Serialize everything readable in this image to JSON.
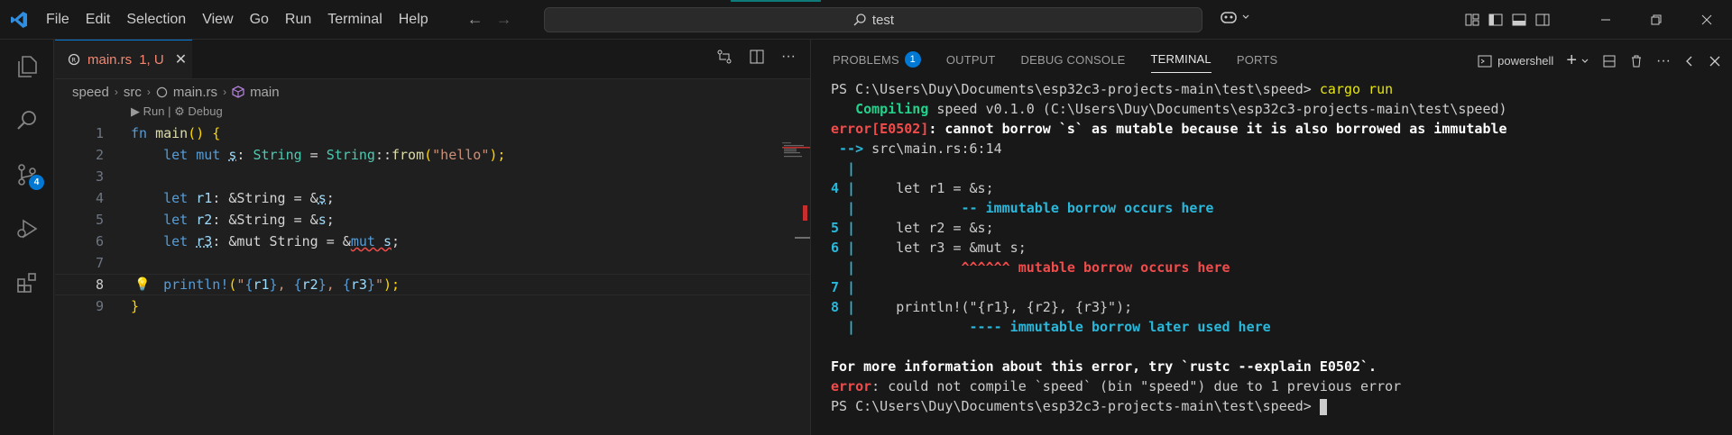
{
  "menu": [
    "File",
    "Edit",
    "Selection",
    "View",
    "Go",
    "Run",
    "Terminal",
    "Help"
  ],
  "search": {
    "text": "test"
  },
  "colors": {
    "accent": "#0078d4",
    "error": "#f14c4c",
    "success": "#23d18b"
  },
  "activity": {
    "scm_badge": "4"
  },
  "editor": {
    "tab": {
      "filename": "main.rs",
      "status": "1, U"
    },
    "breadcrumb": {
      "folder": "speed",
      "sub": "src",
      "file": "main.rs",
      "symbol": "main"
    },
    "codelens": {
      "run": "Run",
      "sep": "|",
      "debug": "Debug"
    },
    "line_numbers": [
      "1",
      "2",
      "3",
      "4",
      "5",
      "6",
      "7",
      "8",
      "9"
    ],
    "active_line": "8",
    "code": {
      "l1_fn": "fn",
      "l1_main": "main",
      "l1_rest": "() {",
      "l2": {
        "let": "let",
        "mut": "mut",
        "s": "s",
        "colon": ": ",
        "type": "String",
        "eq": " = ",
        "type2": "String",
        "path": "::",
        "from": "from",
        "open": "(",
        "str": "\"hello\"",
        "close": ");"
      },
      "l4": {
        "let": "let",
        "name": "r1",
        "rest1": ": &String = &",
        "s": "s",
        "end": ";"
      },
      "l5": {
        "let": "let",
        "name": "r2",
        "rest1": ": &String = &",
        "s": "s",
        "end": ";"
      },
      "l6": {
        "let": "let",
        "name": "r3",
        "rest1": ": &mut String = &",
        "mut": "mut",
        "s": " s",
        "end": ";"
      },
      "l8": {
        "mac": "println!",
        "open": "(",
        "str1": "\"",
        "a1": "{",
        "v1": "r1",
        "a2": "}",
        "c1": ", ",
        "a3": "{",
        "v2": "r2",
        "a4": "}",
        "c2": ", ",
        "a5": "{",
        "v3": "r3",
        "a6": "}",
        "str2": "\"",
        "close": ");"
      },
      "l9": "}"
    }
  },
  "panel": {
    "tabs": [
      "PROBLEMS",
      "OUTPUT",
      "DEBUG CONSOLE",
      "TERMINAL",
      "PORTS"
    ],
    "problems_count": "1",
    "active_tab": "TERMINAL",
    "shell": "powershell",
    "terminal": {
      "prompt": "PS C:\\Users\\Duy\\Documents\\esp32c3-projects-main\\test\\speed> ",
      "cmd": "cargo run",
      "compiling_label": "   Compiling",
      "compiling_rest": " speed v0.1.0 (C:\\Users\\Duy\\Documents\\esp32c3-projects-main\\test\\speed)",
      "err_code": "error[E0502]",
      "err_msg": ": cannot borrow `s` as mutable because it is also borrowed as immutable",
      "arrow": " --> ",
      "location": "src\\main.rs:6:14",
      "pipe_blank": "  |",
      "g4": "4 |",
      "c4": "     let r1 = &s;",
      "n4_pad": "  |             ",
      "n4": "-- immutable borrow occurs here",
      "g5": "5 |",
      "c5": "     let r2 = &s;",
      "g6": "6 |",
      "c6": "     let r3 = &mut s;",
      "n6_pad": "  |             ",
      "n6": "^^^^^^ mutable borrow occurs here",
      "g7": "7 |",
      "g8": "8 |",
      "c8": "     println!(\"{r1}, {r2}, {r3}\");",
      "n8_pad": "  |              ",
      "n8": "---- immutable borrow later used here",
      "info": "For more information about this error, try `rustc --explain E0502`.",
      "err2_label": "error",
      "err2_msg": ": could not compile `speed` (bin \"speed\") due to 1 previous error",
      "prompt2": "PS C:\\Users\\Duy\\Documents\\esp32c3-projects-main\\test\\speed> "
    }
  }
}
